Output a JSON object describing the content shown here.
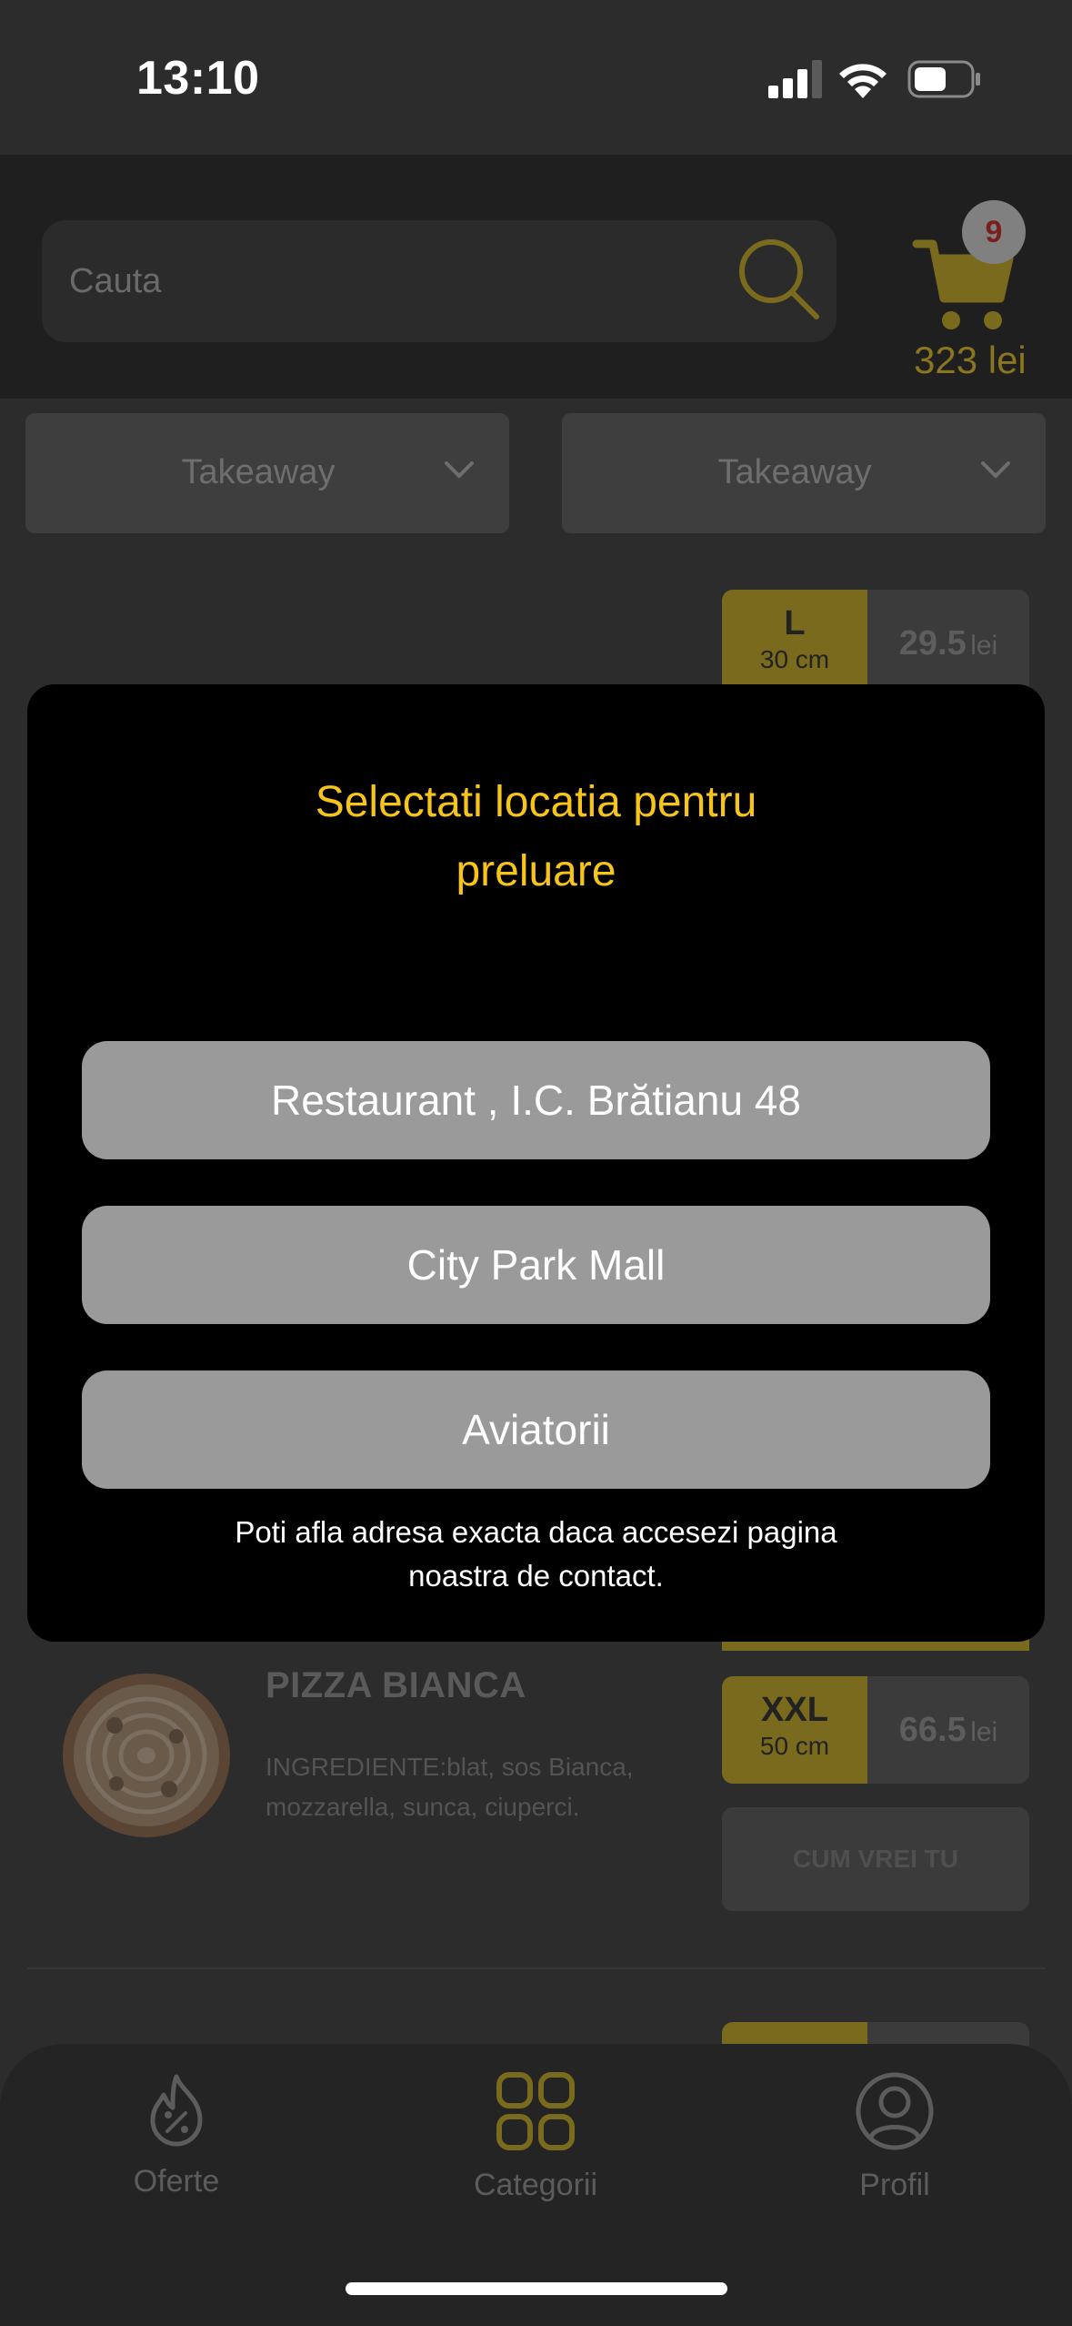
{
  "status_bar": {
    "time": "13:10"
  },
  "search": {
    "placeholder": "Cauta"
  },
  "cart": {
    "count": "9",
    "total": "323 lei"
  },
  "dropdowns": [
    {
      "label": "Takeaway"
    },
    {
      "label": "Takeaway"
    }
  ],
  "products": {
    "top_size": {
      "size": "L",
      "diameter": "30 cm",
      "price": "29.5",
      "currency": "lei"
    },
    "pizza_bianca": {
      "name": "PIZZA BIANCA",
      "description": "INGREDIENTE:blat, sos Bianca, mozzarella, sunca, ciuperci.",
      "size": {
        "size": "XXL",
        "diameter": "50 cm",
        "price": "66.5",
        "currency": "lei"
      },
      "custom_label": "CUM VREI TU"
    }
  },
  "modal": {
    "title": "Selectati locatia pentru preluare",
    "locations": [
      "Restaurant , I.C. Brătianu 48",
      "City Park Mall",
      "Aviatorii"
    ],
    "note": "Poti afla adresa exacta daca accesezi pagina noastra de contact."
  },
  "bottom_nav": [
    {
      "label": "Oferte",
      "icon": "offers-icon"
    },
    {
      "label": "Categorii",
      "icon": "categories-icon"
    },
    {
      "label": "Profil",
      "icon": "profile-icon"
    }
  ],
  "colors": {
    "accent": "#f7c41a",
    "modal_background": "#000000",
    "location_button": "#9a9a9a"
  }
}
